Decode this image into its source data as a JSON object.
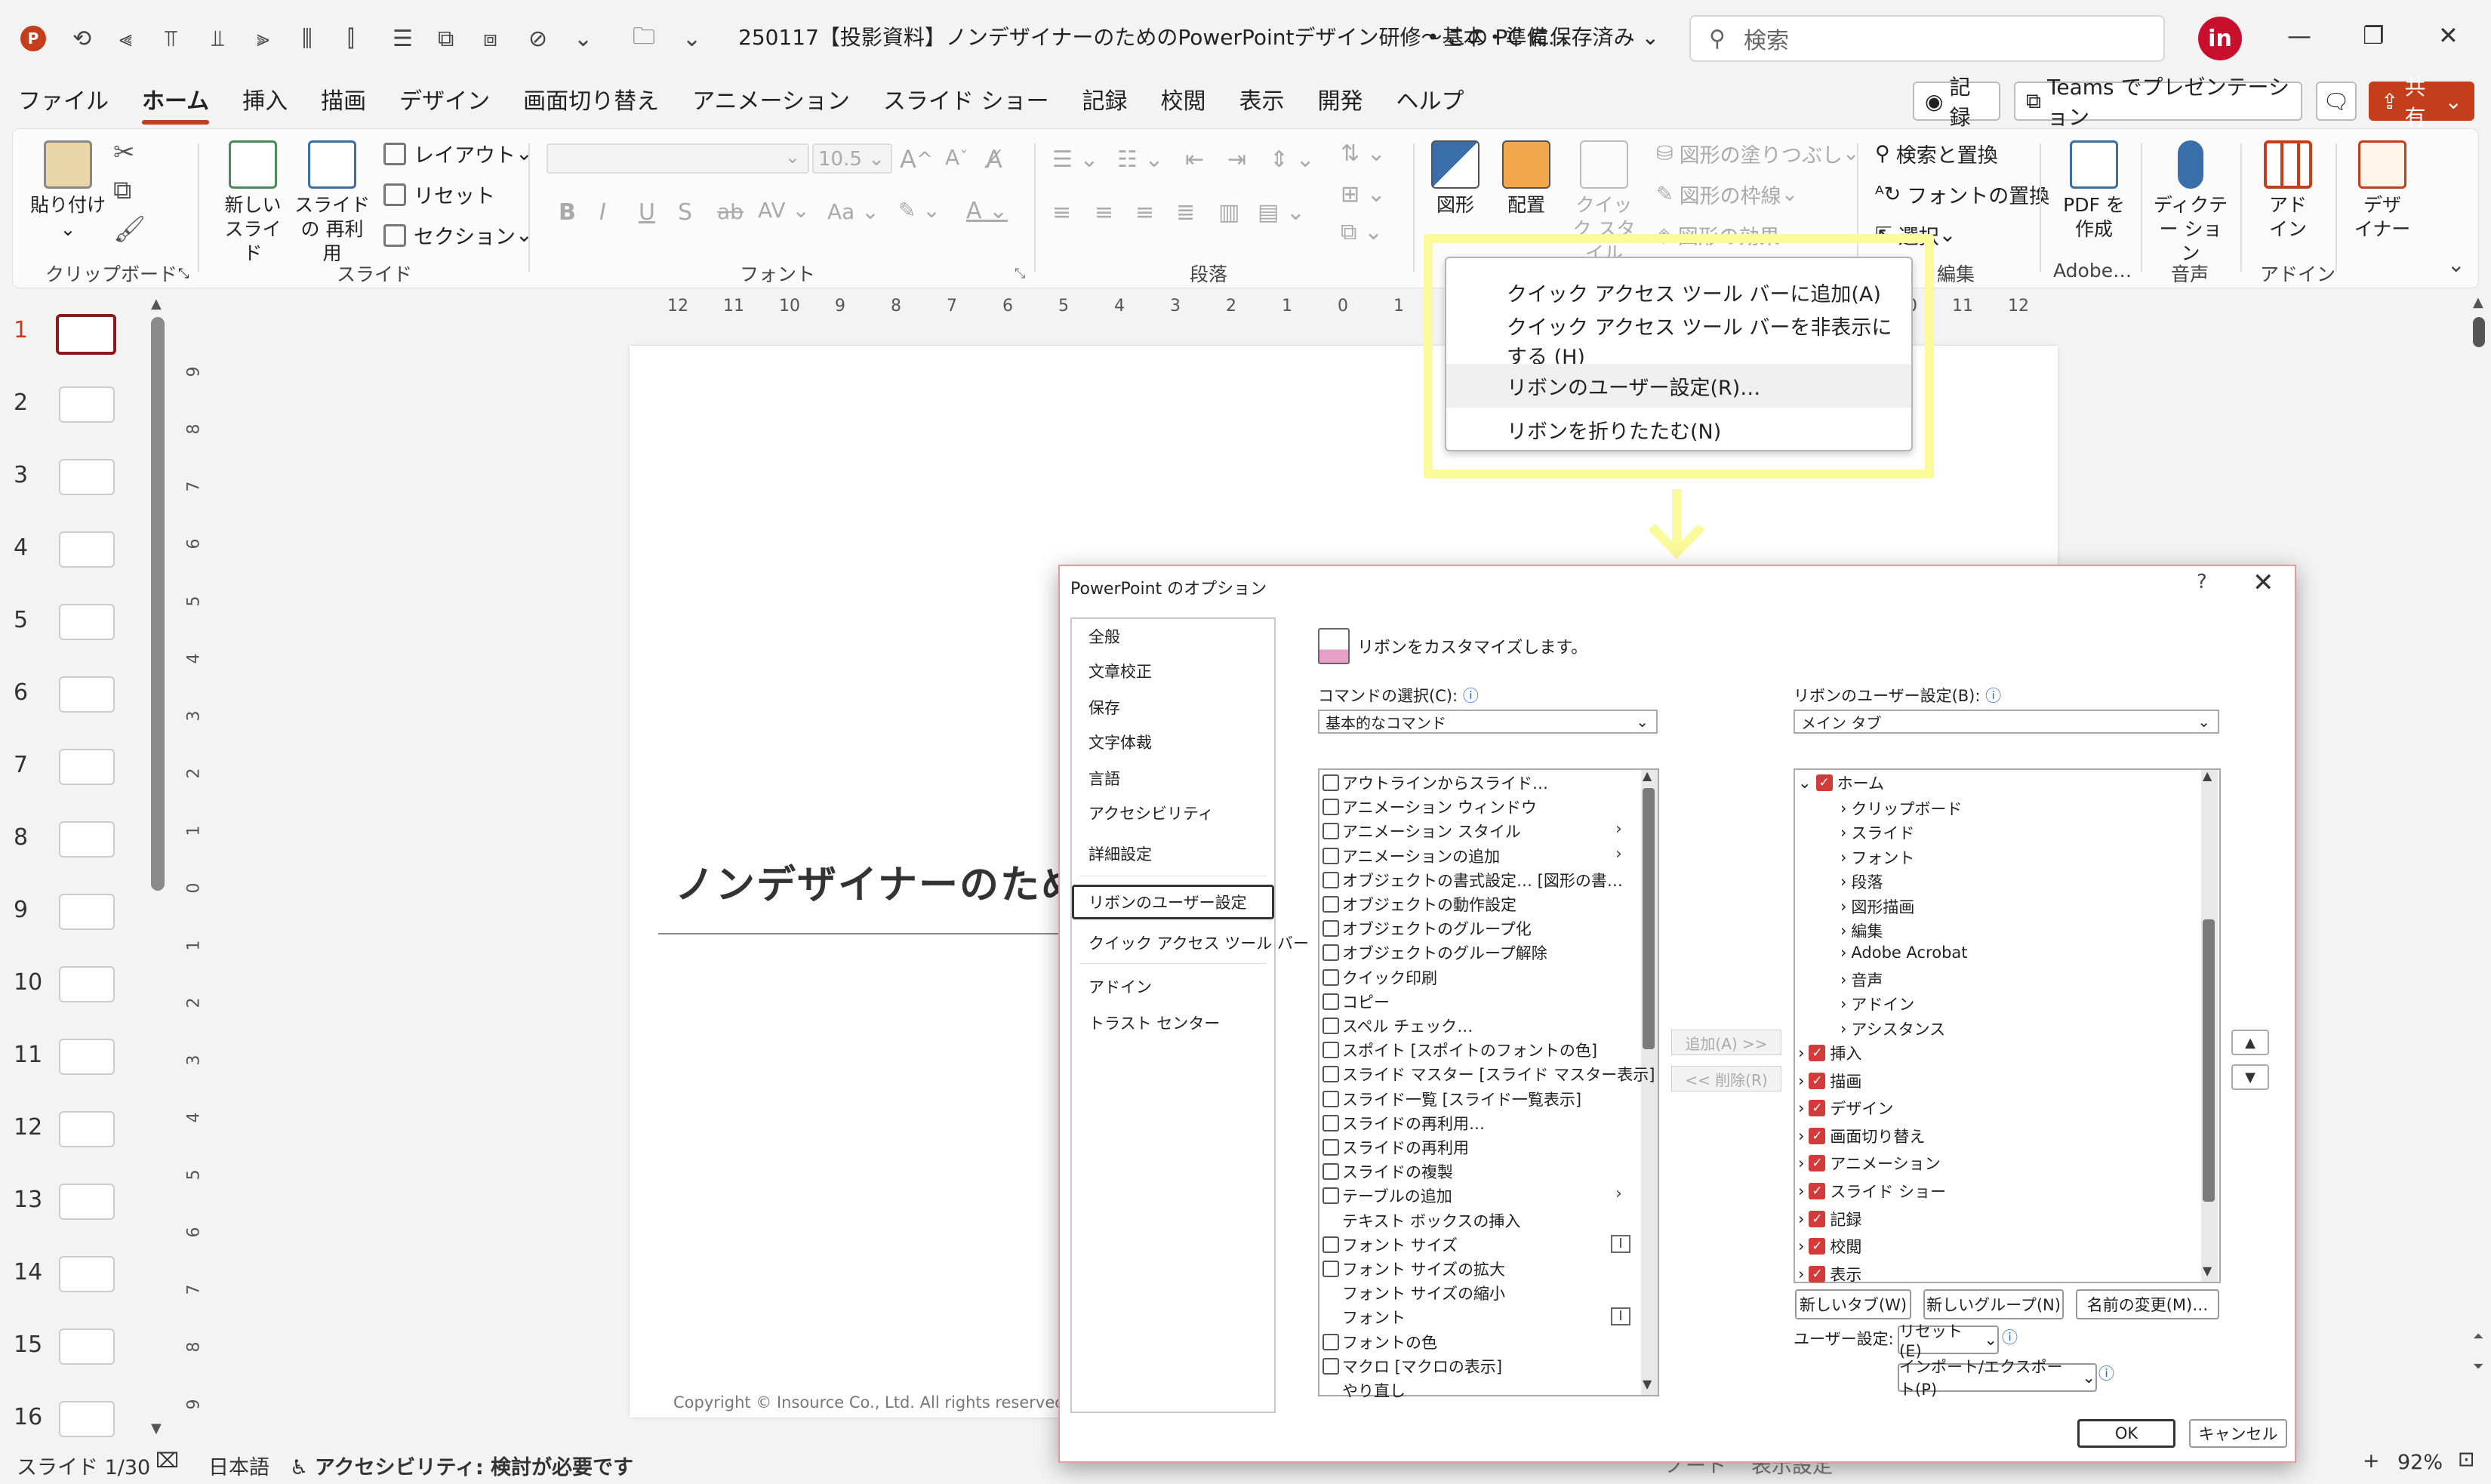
{
  "titlebar": {
    "title": "250117【投影資料】ノンデザイナーのためのPowerPointデザイン研修～基本・準備…",
    "save_status": "• この PC に保存済み",
    "search_placeholder": "検索",
    "avatar": "in"
  },
  "tabs": [
    "ファイル",
    "ホーム",
    "挿入",
    "描画",
    "デザイン",
    "画面切り替え",
    "アニメーション",
    "スライド ショー",
    "記録",
    "校閲",
    "表示",
    "開発",
    "ヘルプ"
  ],
  "active_tab": "ホーム",
  "top_buttons": {
    "record": "記録",
    "teams": "Teams でプレゼンテーション",
    "share": "共有"
  },
  "ribbon": {
    "clipboard": {
      "paste": "貼り付け",
      "label": "クリップボード"
    },
    "slides": {
      "new_slide": "新しい スライド",
      "reuse": "スライドの 再利用",
      "layout": "レイアウト",
      "reset": "リセット",
      "section": "セクション",
      "label": "スライド"
    },
    "font": {
      "size": "10.5",
      "label": "フォント"
    },
    "paragraph": {
      "label": "段落"
    },
    "drawing": {
      "shape": "図形",
      "arrange": "配置",
      "quick_style": "クイック スタイル",
      "fill": "図形の塗りつぶし",
      "outline": "図形の枠線",
      "effect": "図形の効果"
    },
    "editing": {
      "find_replace": "検索と置換",
      "font_replace": "フォントの置換",
      "select": "選択",
      "label": "編集"
    },
    "adobe": {
      "pdf": "PDF を作成",
      "label": "Adobe…"
    },
    "voice": {
      "dictate": "ディクテー ション",
      "label": "音声"
    },
    "addin": {
      "addin": "アド イン",
      "label": "アドイン"
    },
    "designer": {
      "designer": "デザ イナー"
    }
  },
  "ruler_ticks": [
    "12",
    "11",
    "10",
    "9",
    "8",
    "7",
    "6",
    "5",
    "4",
    "3",
    "2",
    "1",
    "0",
    "1",
    "2",
    "3",
    "4",
    "5",
    "6",
    "7",
    "8",
    "9",
    "10",
    "11",
    "12"
  ],
  "vruler_ticks": [
    "9",
    "8",
    "7",
    "6",
    "5",
    "4",
    "3",
    "2",
    "1",
    "0",
    "1",
    "2",
    "3",
    "4",
    "5",
    "6",
    "7",
    "8",
    "9"
  ],
  "thumbnails": [
    "1",
    "2",
    "3",
    "4",
    "5",
    "6",
    "7",
    "8",
    "9",
    "10",
    "11",
    "12",
    "13",
    "14",
    "15",
    "16"
  ],
  "slide": {
    "title": "ノンデザイナーのため",
    "copyright": "Copyright © Insource Co., Ltd. All rights reserved."
  },
  "context_menu": [
    "クイック アクセス ツール バーに追加(A)",
    "クイック アクセス ツール バーを非表示にする (H)",
    "リボンのユーザー設定(R)…",
    "リボンを折りたたむ(N)"
  ],
  "dialog": {
    "title": "PowerPoint のオプション",
    "help": "?",
    "close": "✕",
    "nav": [
      "全般",
      "文章校正",
      "保存",
      "文字体裁",
      "言語",
      "アクセシビリティ",
      "詳細設定",
      "リボンのユーザー設定",
      "クイック アクセス ツール バー",
      "アドイン",
      "トラスト センター"
    ],
    "heading": "リボンをカスタマイズします。",
    "commands_label": "コマンドの選択(C):",
    "commands_value": "基本的なコマンド",
    "ribbon_label": "リボンのユーザー設定(B):",
    "ribbon_value": "メイン タブ",
    "commands": [
      "アウトラインからスライド…",
      "アニメーション ウィンドウ",
      "アニメーション スタイル",
      "アニメーションの追加",
      "オブジェクトの書式設定… [図形の書…",
      "オブジェクトの動作設定",
      "オブジェクトのグループ化",
      "オブジェクトのグループ解除",
      "クイック印刷",
      "コピー",
      "スペル チェック…",
      "スポイト [スポイトのフォントの色]",
      "スライド マスター [スライド マスター表示]",
      "スライド一覧 [スライド一覧表示]",
      "スライドの再利用…",
      "スライドの再利用",
      "スライドの複製",
      "テーブルの追加",
      "テキスト ボックスの挿入",
      "フォント サイズ",
      "フォント サイズの拡大",
      "フォント サイズの縮小",
      "フォント",
      "フォントの色",
      "マクロ [マクロの表示]",
      "やり直し"
    ],
    "add_btn": "追加(A) >>",
    "remove_btn": "<< 削除(R)",
    "tree_home": "ホーム",
    "tree_home_children": [
      "クリップボード",
      "スライド",
      "フォント",
      "段落",
      "図形描画",
      "編集",
      "Adobe Acrobat",
      "音声",
      "アドイン",
      "アシスタンス"
    ],
    "tree_tabs": [
      "挿入",
      "描画",
      "デザイン",
      "画面切り替え",
      "アニメーション",
      "スライド ショー",
      "記録",
      "校閲",
      "表示"
    ],
    "new_tab": "新しいタブ(W)",
    "new_group": "新しいグループ(N)",
    "rename": "名前の変更(M)…",
    "user_settings": "ユーザー設定:",
    "reset": "リセット(E)",
    "import_export": "インポート/エクスポート(P)",
    "ok": "OK",
    "cancel": "キャンセル"
  },
  "status": {
    "slide": "スライド 1/30",
    "lang": "日本語",
    "accessibility": "アクセシビリティ: 検討が必要です",
    "notes": "ノート",
    "display": "表示設定",
    "zoom": "92%"
  },
  "colors": {
    "accent": "#c43e1c",
    "highlight": "#fafa9a",
    "checkbox": "#d33b3b"
  }
}
